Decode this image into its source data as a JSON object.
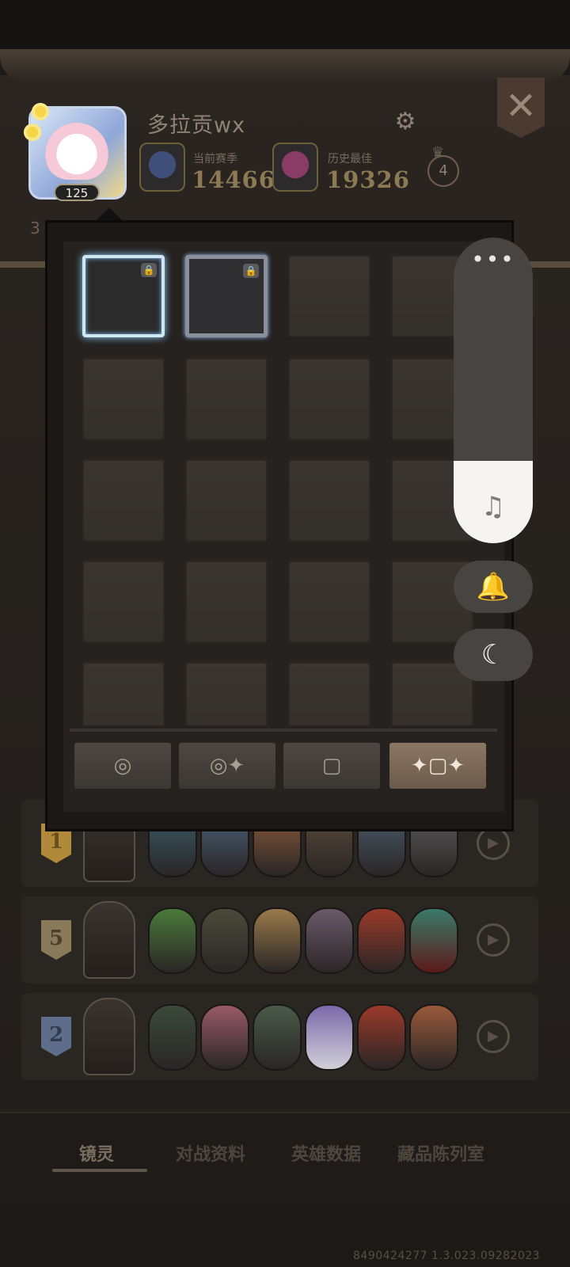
{
  "header": {
    "avatar_level": "125",
    "player_name": "多拉贡wx",
    "current_season_label": "当前赛季",
    "current_season_value": "14466",
    "best_label": "历史最佳",
    "best_value": "19326",
    "crown_count": "4",
    "season_number": "3"
  },
  "popup": {
    "rows": 5,
    "columns": 4,
    "unlocked_frames": [
      "lightning-frame",
      "steampunk-frame"
    ],
    "tabs": [
      {
        "icon": "egg-icon",
        "active": false
      },
      {
        "icon": "sparkle-egg-icon",
        "active": false
      },
      {
        "icon": "square-frame-icon",
        "active": false
      },
      {
        "icon": "sparkle-frame-icon",
        "active": true
      }
    ]
  },
  "system_panel": {
    "more": "•••",
    "volume_level": 0.27
  },
  "lineups": [
    {
      "rank": "1",
      "rank_color": "#b08a3a"
    },
    {
      "rank": "5",
      "rank_color": "#8a7a5a"
    },
    {
      "rank": "2",
      "rank_color": "#5e6e8a"
    }
  ],
  "bottom_nav": {
    "items": [
      "镜灵",
      "对战资料",
      "英雄数据",
      "藏品陈列室"
    ],
    "active_index": 0
  },
  "version": "8490424277 1.3.023.09282023"
}
